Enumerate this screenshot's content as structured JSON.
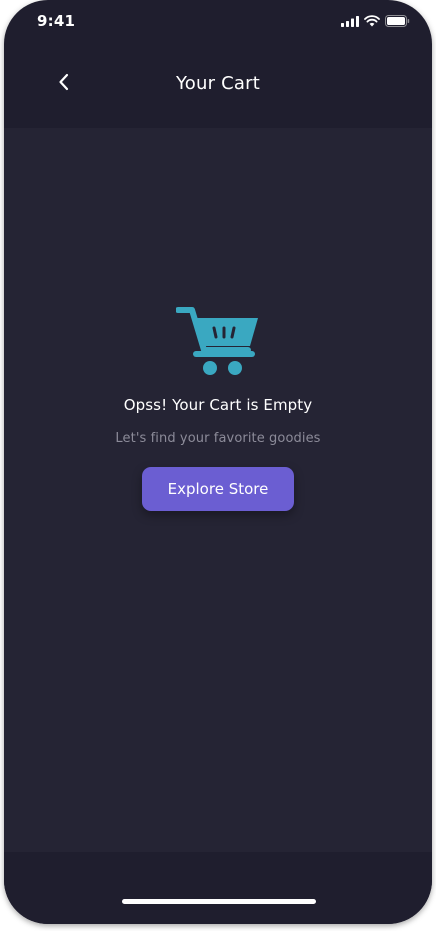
{
  "status_bar": {
    "time": "9:41",
    "icons": [
      "cellular-signal-icon",
      "wifi-icon",
      "battery-icon"
    ]
  },
  "header": {
    "title": "Your Cart",
    "back_icon": "chevron-left-icon"
  },
  "empty_state": {
    "icon": "shopping-cart-icon",
    "title": "Opss! Your Cart is Empty",
    "subtitle": "Let's find your favorite goodies",
    "button_label": "Explore Store"
  },
  "colors": {
    "background": "#1f1e2e",
    "content_background": "#252434",
    "accent_button": "#6b5ed2",
    "cart_icon": "#3aa8c1",
    "subtitle_text": "#8c8b99"
  }
}
